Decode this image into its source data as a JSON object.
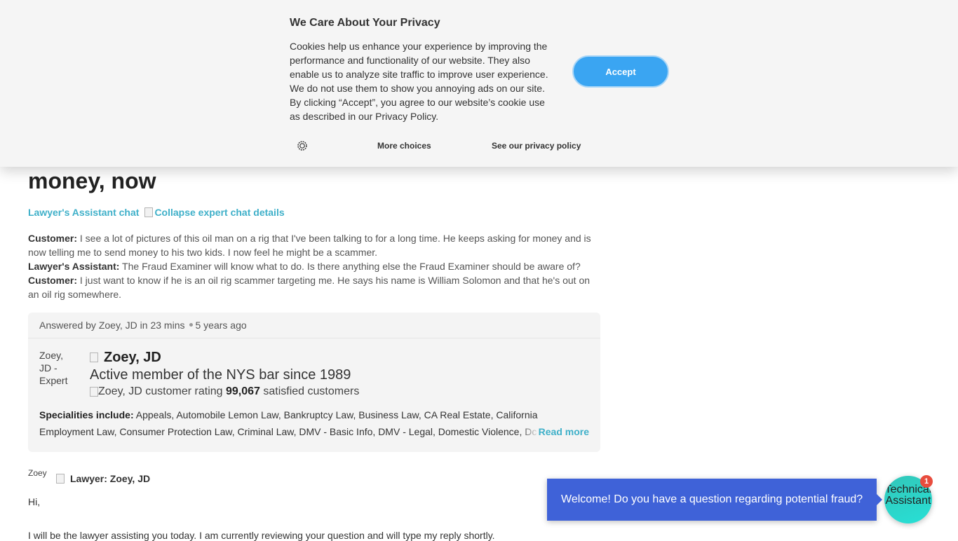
{
  "page": {
    "title": "money, now",
    "chat_link": "Lawyer's Assistant chat",
    "collapse_link": "Collapse expert chat details",
    "transcript": [
      {
        "speaker": "Customer:",
        "text": " I see a lot of pictures of this oil man on a rig that I've been talking to for a long time. He keeps asking for money and is now telling me to send money to his two kids. I now feel he might be a scammer."
      },
      {
        "speaker": "Lawyer's Assistant:",
        "text": " The Fraud Examiner will know what to do. Is there anything else the Fraud Examiner should be aware of?"
      },
      {
        "speaker": "Customer:",
        "text": " I just want to know if he is an oil rig scammer targeting me. He says his name is William Solomon and that he's out on an oil rig somewhere."
      }
    ]
  },
  "answer": {
    "answered_by": "Answered by Zoey, JD in 23 mins",
    "age": "5 years ago",
    "avatar_alt": "Zoey, JD - Expert",
    "expert_name": "Zoey, JD",
    "expert_tagline": "Active member of the NYS bar since 1989",
    "rating_alt": "Zoey, JD customer rating",
    "satisfied_count": "99,067",
    "satisfied_label": " satisfied customers",
    "specialities_label": "Specialities include:",
    "specialities_text": " Appeals, Automobile Lemon Law, Bankruptcy Law, Business Law, CA Real Estate, California Employment Law, Consumer Protection Law, Criminal Law, DMV - Basic Info, DMV - Legal, Domestic Violence, Dc",
    "read_more": "Read more"
  },
  "lawyer": {
    "avatar_alt": "Zoey",
    "label": "Lawyer: Zoey, JD",
    "greeting": "Hi,",
    "message": "I will be the lawyer assisting you today. I am currently reviewing your question and will type my reply shortly."
  },
  "cookie": {
    "heading": "We Care About Your Privacy",
    "body": "Cookies help us enhance your experience by improving the performance and functionality of our website. They also enable us to analyze site traffic to improve user experience. We do not use them to show you annoying ads on our site. By clicking “Accept”, you agree to our website’s cookie use as described in our Privacy Policy.",
    "accept": "Accept",
    "more_choices": "More choices",
    "privacy_link": "See our privacy policy",
    "settings_icon": "gear-icon"
  },
  "chat_widget": {
    "message": "Welcome! Do you have a question regarding potential fraud?",
    "button_alt": "Technical Assistant",
    "badge": "1"
  },
  "colors": {
    "link": "#3fb0c9",
    "accept": "#3aa5f2",
    "bubble": "#3f62d8",
    "badge": "#e84c3d"
  }
}
